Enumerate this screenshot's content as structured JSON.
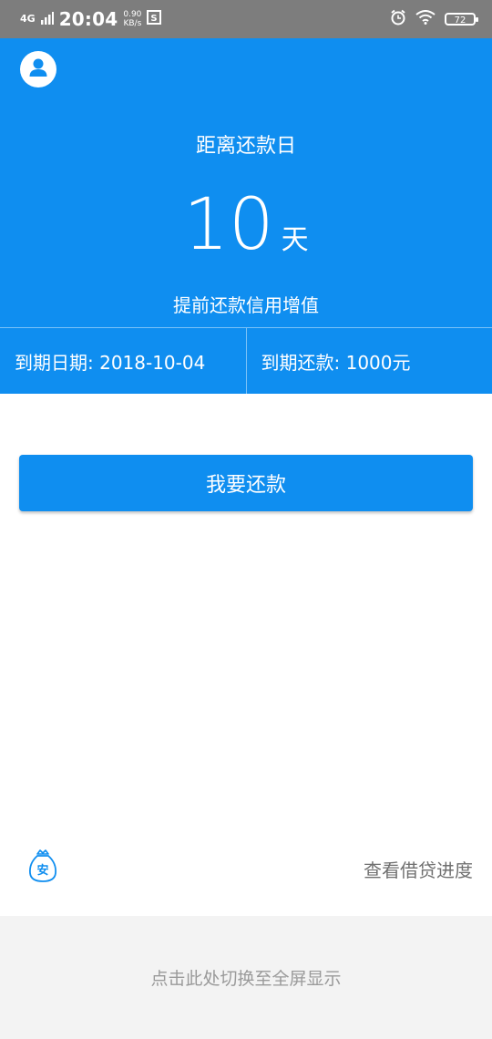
{
  "status_bar": {
    "network": "4G",
    "time": "20:04",
    "speed_value": "0.90",
    "speed_unit": "KB/s",
    "battery": "72"
  },
  "hero": {
    "title": "距离还款日",
    "days": "10",
    "days_unit": "天",
    "subtitle": "提前还款信用增值",
    "due_date_label": "到期日期: 2018-10-04",
    "due_amount_label": "到期还款: 1000元"
  },
  "actions": {
    "repay_button": "我要还款"
  },
  "footer": {
    "badge_char": "安",
    "progress_link": "查看借贷进度",
    "fullscreen_hint": "点击此处切换至全屏显示"
  },
  "colors": {
    "primary": "#0f8ef0",
    "status_bar": "#7d7d7d"
  }
}
